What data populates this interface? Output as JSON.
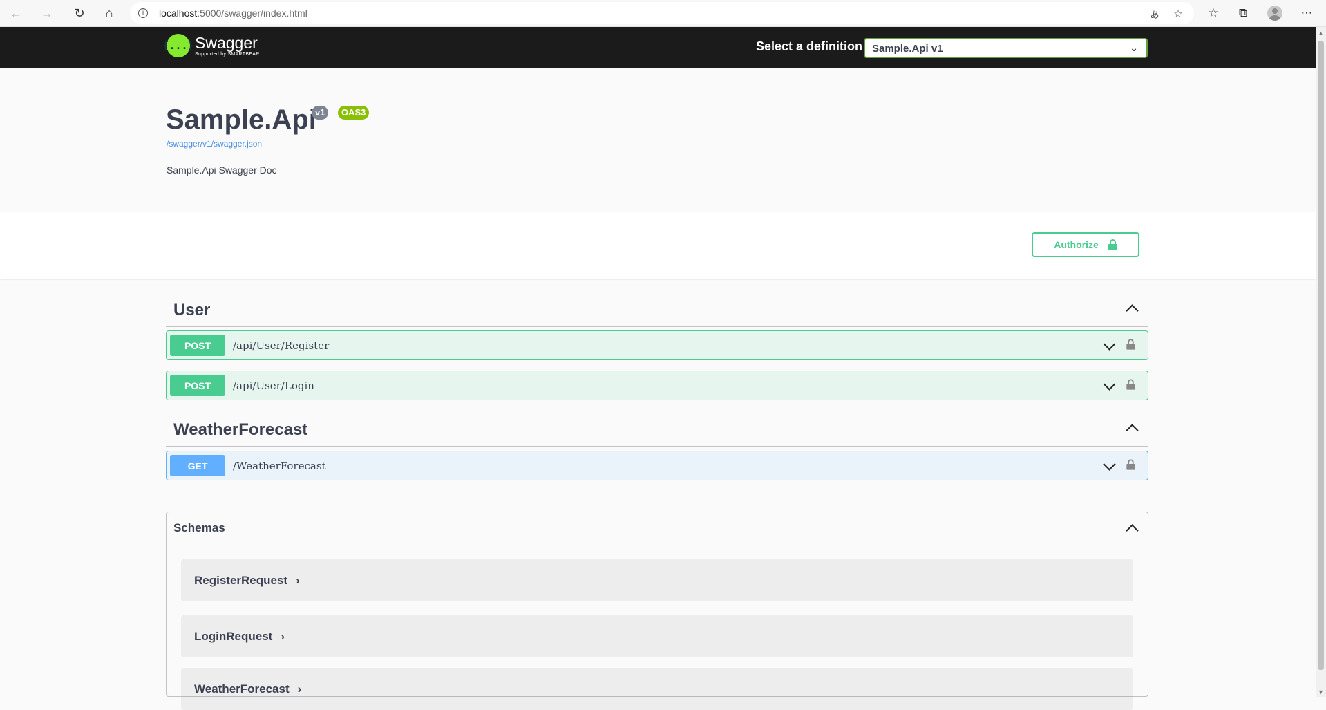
{
  "browser": {
    "url_host": "localhost",
    "url_path": ":5000/swagger/index.html",
    "translate_icon": "あ",
    "icons": {
      "back": "arrow-left-icon",
      "forward": "arrow-right-icon",
      "refresh": "refresh-icon",
      "home": "home-icon",
      "info": "info-icon",
      "read_aloud": "translate-icon",
      "favorite": "star-add-icon",
      "favorites": "favorites-icon",
      "collections": "collections-icon",
      "profile": "profile-icon",
      "menu": "more-icon"
    }
  },
  "topbar": {
    "logo_name": "Swagger",
    "logo_sub": "Supported by SMARTBEAR",
    "logo_glyph": "{...}",
    "definition_label": "Select a definition",
    "definition_selected": "Sample.Api v1"
  },
  "info": {
    "title": "Sample.Api",
    "version_badge": "v1",
    "oas_badge": "OAS3",
    "spec_link": "/swagger/v1/swagger.json",
    "description": "Sample.Api Swagger Doc"
  },
  "scheme": {
    "authorize_label": "Authorize"
  },
  "tags": [
    {
      "name": "User",
      "operations": [
        {
          "method": "POST",
          "path": "/api/User/Register"
        },
        {
          "method": "POST",
          "path": "/api/User/Login"
        }
      ]
    },
    {
      "name": "WeatherForecast",
      "operations": [
        {
          "method": "GET",
          "path": "/WeatherForecast"
        }
      ]
    }
  ],
  "schemas": {
    "title": "Schemas",
    "items": [
      "RegisterRequest",
      "LoginRequest",
      "WeatherForecast"
    ]
  },
  "colors": {
    "post": "#49cc90",
    "get": "#61affe",
    "topbar": "#1b1b1b",
    "logo_green": "#85ea2d",
    "select_border": "#62a03f",
    "link": "#4990e2"
  }
}
